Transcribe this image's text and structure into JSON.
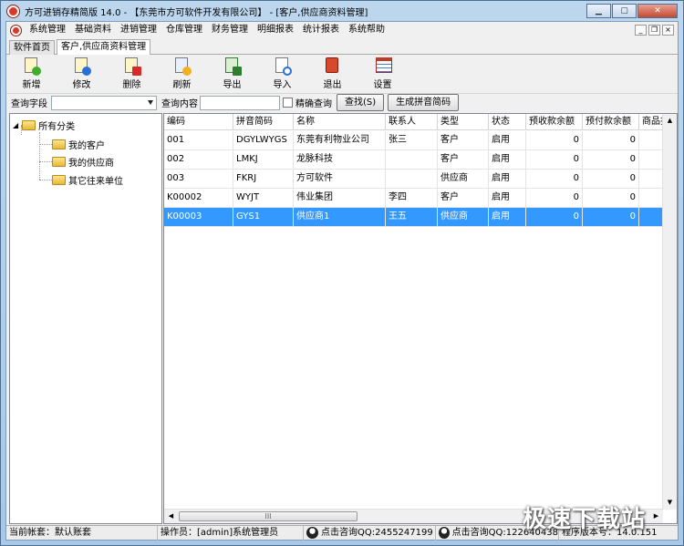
{
  "window": {
    "title": "方可进销存精简版 14.0 - 【东莞市方可软件开发有限公司】 - [客户,供应商资料管理]"
  },
  "menu": [
    "系统管理",
    "基础资料",
    "进销管理",
    "仓库管理",
    "财务管理",
    "明细报表",
    "统计报表",
    "系统帮助"
  ],
  "tabs": [
    "软件首页",
    "客户,供应商资料管理"
  ],
  "toolbar": {
    "add": "新增",
    "edit": "修改",
    "delete": "删除",
    "refresh": "刷新",
    "export": "导出",
    "import": "导入",
    "exit": "退出",
    "settings": "设置"
  },
  "query": {
    "field_label": "查询字段",
    "field_value": "",
    "content_label": "查询内容",
    "content_value": "",
    "exact_label": "精确查询",
    "search_button": "查找(S)",
    "pinyin_button": "生成拼音简码"
  },
  "tree": {
    "root": "所有分类",
    "children": [
      "我的客户",
      "我的供应商",
      "其它往来单位"
    ]
  },
  "grid": {
    "columns": [
      "编码",
      "拼音简码",
      "名称",
      "联系人",
      "类型",
      "状态",
      "预收款余额",
      "预付款余额",
      "商品折"
    ],
    "rows": [
      [
        "001",
        "DGYLWYGS",
        "东莞有利物业公司",
        "张三",
        "客户",
        "启用",
        "0",
        "0",
        ""
      ],
      [
        "002",
        "LMKJ",
        "龙脉科技",
        "",
        "客户",
        "启用",
        "0",
        "0",
        ""
      ],
      [
        "003",
        "FKRJ",
        "方可软件",
        "",
        "供应商",
        "启用",
        "0",
        "0",
        ""
      ],
      [
        "K00002",
        "WYJT",
        "伟业集团",
        "李四",
        "客户",
        "启用",
        "0",
        "0",
        ""
      ],
      [
        "K00003",
        "GYS1",
        "供应商1",
        "王五",
        "供应商",
        "启用",
        "0",
        "0",
        ""
      ]
    ],
    "selected_row": 4,
    "hscroll_grip": "III"
  },
  "status": {
    "account": "当前帐套：默认账套",
    "operator": "操作员：[admin]系统管理员",
    "qq1": "点击咨询QQ:2455247199",
    "qq2": "点击咨询QQ:122640438",
    "version": "程序版本号：14.0.151"
  },
  "watermark": "极速下载站",
  "colors": {
    "selection": "#3399ff",
    "title_gradient": "#bcd6ee"
  }
}
